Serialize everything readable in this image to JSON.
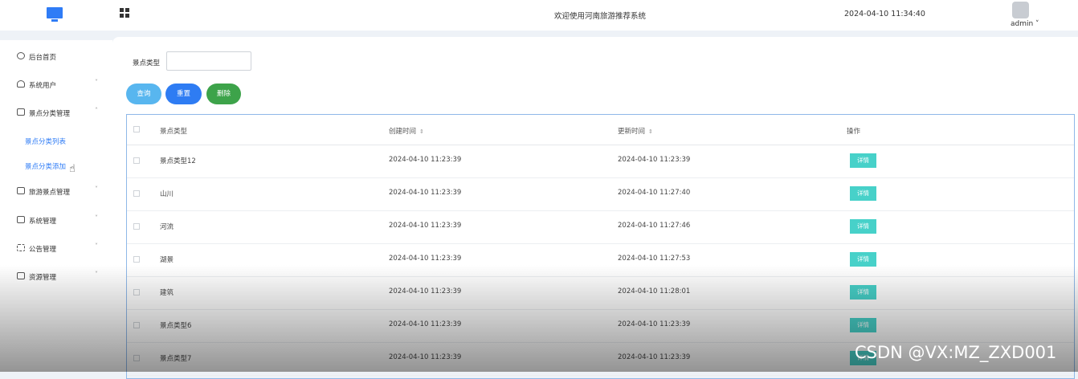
{
  "header": {
    "logo_icon": "monitor-icon",
    "menu_icon": "grid-icon",
    "welcome": "欢迎使用河南旅游推荐系统",
    "datetime": "2024-04-10 11:34:40",
    "user": "admin ˅"
  },
  "sidebar": {
    "items": [
      {
        "icon": "clock-icon",
        "label": "后台首页",
        "arrow": ""
      },
      {
        "icon": "user-icon",
        "label": "系统用户",
        "arrow": "˅"
      },
      {
        "icon": "card-icon",
        "label": "景点分类管理",
        "arrow": "˄"
      },
      {
        "icon": "card-icon",
        "label": "旅游景点管理",
        "arrow": "˅"
      },
      {
        "icon": "folder-icon",
        "label": "系统管理",
        "arrow": "˅"
      },
      {
        "icon": "sparkle-icon",
        "label": "公告管理",
        "arrow": "˅"
      },
      {
        "icon": "box-icon",
        "label": "资源管理",
        "arrow": "˅"
      }
    ],
    "subitems": [
      {
        "label": "景点分类列表"
      },
      {
        "label": "景点分类添加"
      }
    ]
  },
  "filter": {
    "label": "景点类型",
    "value": ""
  },
  "buttons": {
    "query": "查询",
    "reset": "重置",
    "delete": "删除"
  },
  "table": {
    "headers": [
      "景点类型",
      "创建时间",
      "更新时间",
      "操作"
    ],
    "sort_glyph": "⇕",
    "action_label": "详情",
    "rows": [
      {
        "type": "景点类型12",
        "created": "2024-04-10 11:23:39",
        "updated": "2024-04-10 11:23:39"
      },
      {
        "type": "山川",
        "created": "2024-04-10 11:23:39",
        "updated": "2024-04-10 11:27:40"
      },
      {
        "type": "河流",
        "created": "2024-04-10 11:23:39",
        "updated": "2024-04-10 11:27:46"
      },
      {
        "type": "湖景",
        "created": "2024-04-10 11:23:39",
        "updated": "2024-04-10 11:27:53"
      },
      {
        "type": "建筑",
        "created": "2024-04-10 11:23:39",
        "updated": "2024-04-10 11:28:01"
      },
      {
        "type": "景点类型6",
        "created": "2024-04-10 11:23:39",
        "updated": "2024-04-10 11:23:39"
      },
      {
        "type": "景点类型7",
        "created": "2024-04-10 11:23:39",
        "updated": "2024-04-10 11:23:39"
      }
    ]
  },
  "watermark": "CSDN @VX:MZ_ZXD001",
  "colors": {
    "primary": "#2e7cf3",
    "query": "#58b6ef",
    "delete": "#3da34a",
    "detail": "#47d1c9"
  }
}
